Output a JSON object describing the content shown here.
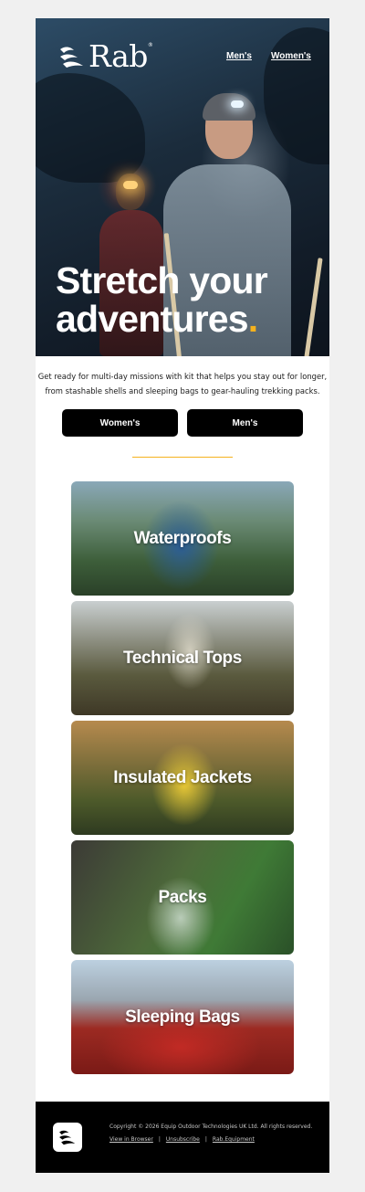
{
  "brand": {
    "name": "Rab",
    "registered": "®"
  },
  "header_nav": [
    {
      "label": "Men's"
    },
    {
      "label": "Women's"
    }
  ],
  "hero": {
    "headline_line1": "Stretch your",
    "headline_line2": "adventures",
    "headline_dot": "."
  },
  "intro": {
    "line1": "Get ready for multi-day missions with kit that helps you stay out for longer,",
    "line2": "from stashable shells and sleeping bags to gear-hauling trekking packs."
  },
  "buttons": {
    "womens": "Women's",
    "mens": "Men's"
  },
  "categories": [
    {
      "label": "Waterproofs"
    },
    {
      "label": "Technical Tops"
    },
    {
      "label": "Insulated Jackets"
    },
    {
      "label": "Packs"
    },
    {
      "label": "Sleeping Bags"
    }
  ],
  "footer": {
    "copyright": "Copyright © 2026 Equip Outdoor Technologies UK Ltd. All rights reserved.",
    "links": [
      "View in Browser",
      "Unsubscribe",
      "Rab.Equipment"
    ],
    "separator": "|"
  },
  "colors": {
    "accent": "#f5b21e",
    "button_bg": "#000000",
    "page_bg": "#f0f0f0"
  }
}
